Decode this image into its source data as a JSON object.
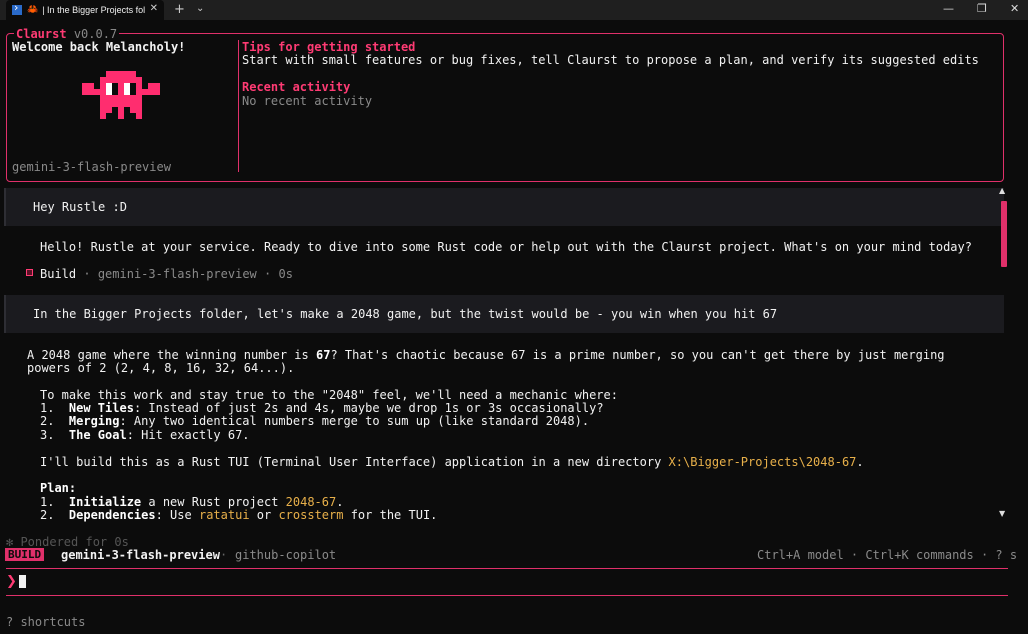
{
  "window": {
    "tab_title": "| In the Bigger Projects fol",
    "tab_shell_icon": "powershell-icon",
    "tab_app_icon": "crab-icon",
    "new_tab_label": "+",
    "dropdown_label": "⌄",
    "minimize_label": "—",
    "maximize_label": "❐",
    "close_label": "✕"
  },
  "welcome": {
    "app_name": "Claurst",
    "version": "v0.0.7",
    "greeting": "Welcome back Melancholy!",
    "model": "gemini-3-flash-preview",
    "tips_title": "Tips for getting started",
    "tips_text": "Start with small features or bug fixes, tell Claurst to propose a plan, and verify its suggested edits",
    "recent_title": "Recent activity",
    "recent_text": "No recent activity",
    "mascot_color": "#ff2d6f"
  },
  "conversation": {
    "user_1": "Hey Rustle :D",
    "assistant_1": "Hello! Rustle at your service. Ready to dive into some Rust code or help out with the Claurst project. What's on your mind today?",
    "status": {
      "mode": "Build",
      "sep1": "·",
      "model": "gemini-3-flash-preview",
      "sep2": "·",
      "duration": "0s"
    },
    "user_2": "In the Bigger Projects folder, let's make a 2048 game, but the twist would be - you win when you hit 67",
    "a2": {
      "l1_pre": "A 2048 game where the winning number is ",
      "l1_bold": "67",
      "l1_post": "? That's chaotic because 67 is a prime number, so you can't get there by just merging",
      "l2": "powers of 2 (2, 4, 8, 16, 32, 64...).",
      "l3": "To make this work and stay true to the \"2048\" feel, we'll need a mechanic where:",
      "item1_num": "1.",
      "item1_bold": "New Tiles",
      "item1_rest": ": Instead of just 2s and 4s, maybe we drop 1s or 3s occasionally?",
      "item2_num": "2.",
      "item2_bold": "Merging",
      "item2_rest": ": Any two identical numbers merge to sum up (like standard 2048).",
      "item3_num": "3.",
      "item3_bold": "The Goal",
      "item3_rest": ": Hit exactly 67.",
      "build_pre": "I'll build this as a Rust TUI (Terminal User Interface) application in a new directory ",
      "build_path": "X:\\Bigger-Projects\\2048-67",
      "build_post": ".",
      "plan_title": "Plan:",
      "plan1_num": "1.",
      "plan1_bold": "Initialize",
      "plan1_pre": " a new Rust project ",
      "plan1_hl": "2048-67",
      "plan1_post": ".",
      "plan2_num": "2.",
      "plan2_bold": "Dependencies",
      "plan2_pre": ": Use ",
      "plan2_hl1": "ratatui",
      "plan2_mid": " or ",
      "plan2_hl2": "crossterm",
      "plan2_post": " for the TUI."
    }
  },
  "scrollbar": {
    "up_label": "▲",
    "down_label": "▼"
  },
  "footer": {
    "pondered": "✻ Pondered for 0s",
    "mode_badge": "BUILD",
    "model": "gemini-3-flash-preview",
    "sep": "·",
    "provider": "github-copilot",
    "hints": "Ctrl+A model · Ctrl+K commands · ? s",
    "prompt_symbol": "❯",
    "input_value": "",
    "shortcuts": "? shortcuts"
  }
}
